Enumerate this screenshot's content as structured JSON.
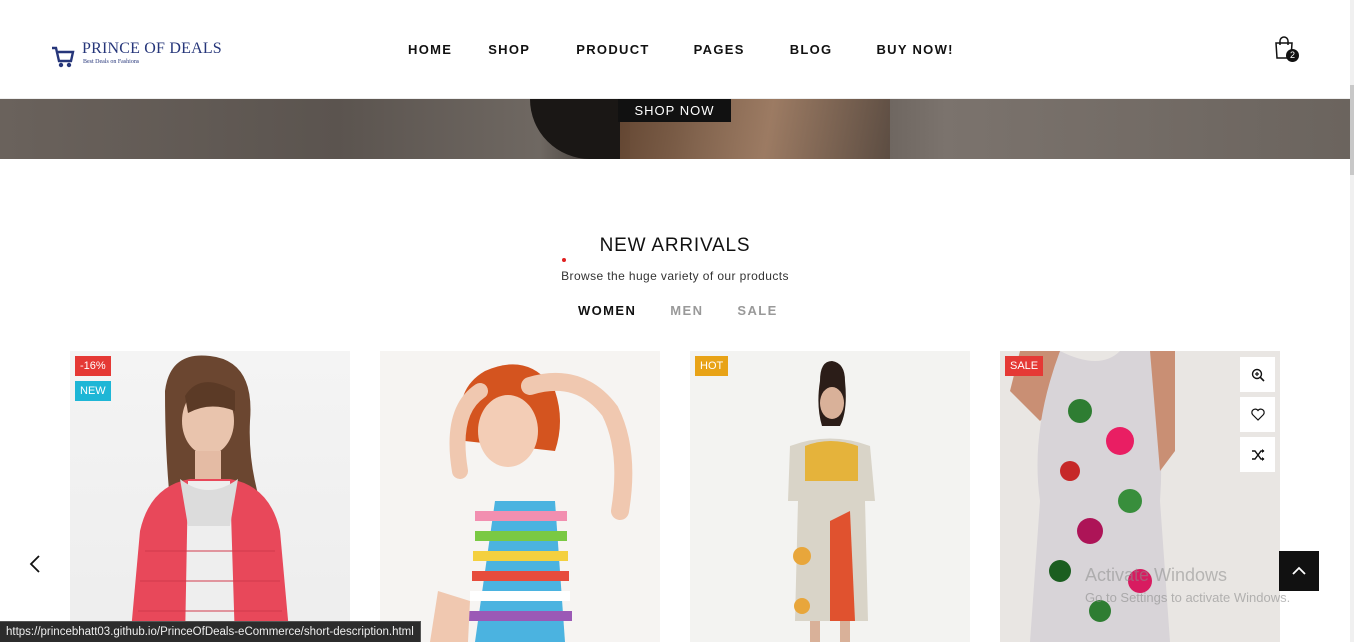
{
  "header": {
    "logo_title": "PRINCE OF DEALS",
    "logo_subtitle": "Best Deals on Fashions",
    "nav": [
      "HOME",
      "SHOP",
      "PRODUCT",
      "PAGES",
      "BLOG",
      "BUY NOW!"
    ],
    "cart_count": "2"
  },
  "hero": {
    "button_label": "SHOP NOW"
  },
  "section": {
    "title": "NEW ARRIVALS",
    "subtitle": "Browse the huge variety of our products",
    "tabs": [
      "WOMEN",
      "MEN",
      "SALE"
    ],
    "active_tab": "WOMEN"
  },
  "products": [
    {
      "badges": [
        "-16%",
        "NEW"
      ]
    },
    {
      "badges": []
    },
    {
      "badges": [
        "HOT"
      ]
    },
    {
      "badges": [
        "SALE"
      ]
    }
  ],
  "watermark": {
    "line1": "Activate Windows",
    "line2": "Go to Settings to activate Windows."
  },
  "status_bar": {
    "url": "https://princebhatt03.github.io/PrinceOfDeals-eCommerce/short-description.html"
  },
  "colors": {
    "accent_sale": "#e53935",
    "accent_new": "#1eb6d6",
    "accent_hot": "#e8a317",
    "logo": "#26367a"
  }
}
